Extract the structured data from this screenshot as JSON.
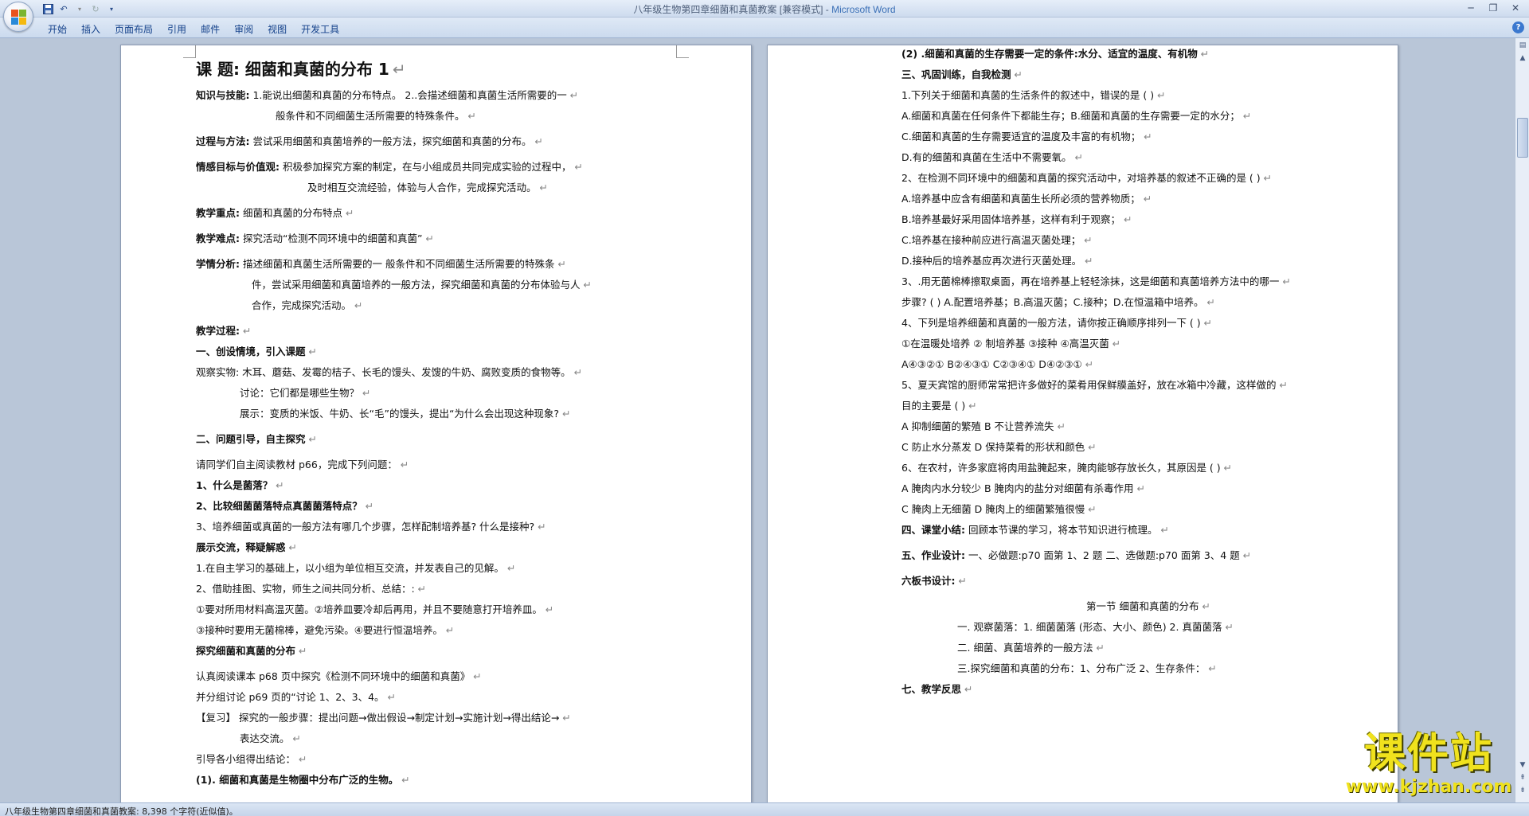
{
  "window": {
    "doc_name": "八年级生物第四章细菌和真菌教案 [兼容模式]",
    "separator": " - ",
    "app_name": "Microsoft Word"
  },
  "tabs": [
    "开始",
    "插入",
    "页面布局",
    "引用",
    "邮件",
    "审阅",
    "视图",
    "开发工具"
  ],
  "status": "八年级生物第四章细菌和真菌教案: 8,398 个字符(近似值)。",
  "watermark": {
    "logo": "课件站",
    "url": "www.kjzhan.com"
  },
  "left_page": [
    {
      "t": "课  题:            细菌和真菌的分布               1",
      "s": "h1"
    },
    {
      "t": "知识与技能:  1.能说出细菌和真菌的分布特点。 2..会描述细菌和真菌生活所需要的一",
      "s": "b-lead"
    },
    {
      "t": "般条件和不同细菌生活所需要的特殊条件。",
      "s": "ind1"
    },
    {
      "t": "过程与方法:   尝试采用细菌和真菌培养的一般方法，探究细菌和真菌的分布。",
      "s": "b-lead gap"
    },
    {
      "t": "情感目标与价值观:   积极参加探究方案的制定，在与小组成员共同完成实验的过程中，",
      "s": "b-lead gap"
    },
    {
      "t": "及时相互交流经验，体验与人合作，完成探究活动。",
      "s": "ind4"
    },
    {
      "t": "教学重点:   细菌和真菌的分布特点",
      "s": "b-lead gap"
    },
    {
      "t": "教学难点:    探究活动“检测不同环境中的细菌和真菌”",
      "s": "b-lead gap"
    },
    {
      "t": "学情分析: 描述细菌和真菌生活所需要的一   般条件和不同细菌生活所需要的特殊条",
      "s": "b-lead gap"
    },
    {
      "t": "件，尝试采用细菌和真菌培养的一般方法，探究细菌和真菌的分布体验与人",
      "s": "ind3"
    },
    {
      "t": "合作，完成探究活动。",
      "s": "ind3"
    },
    {
      "t": "教学过程:",
      "s": "b gap"
    },
    {
      "t": "一、创设情境，引入课题",
      "s": "b"
    },
    {
      "t": "观察实物: 木耳、蘑菇、发霉的桔子、长毛的馒头、发馊的牛奶、腐败变质的食物等。",
      "s": ""
    },
    {
      "t": "讨论：它们都是哪些生物？",
      "s": "ind2"
    },
    {
      "t": "展示：变质的米饭、牛奶、长“毛”的馒头，提出“为什么会出现这种现象?",
      "s": "ind2"
    },
    {
      "t": "二、问题引导，自主探究",
      "s": "b gap"
    },
    {
      "t": " 请同学们自主阅读教材 p66，完成下列问题：",
      "s": "gap"
    },
    {
      "t": "1、什么是菌落？",
      "s": "b"
    },
    {
      "t": "2、比较细菌菌落特点真菌菌落特点？",
      "s": "b"
    },
    {
      "t": "3、培养细菌或真菌的一般方法有哪几个步骤，怎样配制培养基? 什么是接种?",
      "s": ""
    },
    {
      "t": "展示交流，释疑解惑",
      "s": "b"
    },
    {
      "t": "1.在自主学习的基础上，以小组为单位相互交流，并发表自己的见解。",
      "s": ""
    },
    {
      "t": "2、借助挂图、实物，师生之间共同分析、总结：:",
      "s": ""
    },
    {
      "t": "①要对所用材料高温灭菌。②培养皿要冷却后再用，并且不要随意打开培养皿。",
      "s": ""
    },
    {
      "t": "③接种时要用无菌棉棒，避免污染。④要进行恒温培养。",
      "s": ""
    },
    {
      "t": "探究细菌和真菌的分布",
      "s": "b"
    },
    {
      "t": "认真阅读课本 p68 页中探究《检测不同环境中的细菌和真菌》",
      "s": "gap"
    },
    {
      "t": "并分组讨论 p69 页的“讨论 1、2、3、4。",
      "s": ""
    },
    {
      "t": "【复习】 探究的一般步骤：提出问题→做出假设→制定计划→实施计划→得出结论→",
      "s": ""
    },
    {
      "t": "表达交流。",
      "s": "ind2"
    },
    {
      "t": "引导各小组得出结论：",
      "s": ""
    },
    {
      "t": " (1). 细菌和真菌是生物圈中分布广泛的生物。",
      "s": "b"
    }
  ],
  "right_page": [
    {
      "t": " (2) .细菌和真菌的生存需要一定的条件:水分、适宜的温度、有机物",
      "s": "b"
    },
    {
      "t": "三、巩固训练，自我检测",
      "s": "b"
    },
    {
      "t": "1.下列关于细菌和真菌的生活条件的叙述中，错误的是 (      )",
      "s": ""
    },
    {
      "t": "A.细菌和真菌在任何条件下都能生存；B.细菌和真菌的生存需要一定的水分；",
      "s": ""
    },
    {
      "t": "C.细菌和真菌的生存需要适宜的温度及丰富的有机物；",
      "s": ""
    },
    {
      "t": "D.有的细菌和真菌在生活中不需要氧。",
      "s": ""
    },
    {
      "t": "2、在检测不同环境中的细菌和真菌的探究活动中，对培养基的叙述不正确的是 (     )",
      "s": ""
    },
    {
      "t": "A.培养基中应含有细菌和真菌生长所必须的营养物质；",
      "s": ""
    },
    {
      "t": "B.培养基最好采用固体培养基，这样有利于观察；",
      "s": ""
    },
    {
      "t": "C.培养基在接种前应进行高温灭菌处理；",
      "s": ""
    },
    {
      "t": "D.接种后的培养基应再次进行灭菌处理。",
      "s": ""
    },
    {
      "t": "3、.用无菌棉棒擦取桌面，再在培养基上轻轻涂抹，这是细菌和真菌培养方法中的哪一",
      "s": ""
    },
    {
      "t": "步骤? (     )        A.配置培养基；B.高温灭菌；C.接种；D.在恒温箱中培养。",
      "s": ""
    },
    {
      "t": "4、下列是培养细菌和真菌的一般方法，请你按正确顺序排列一下 (      )",
      "s": ""
    },
    {
      "t": "①在温暖处培养      ② 制培养基       ③接种          ④高温灭菌",
      "s": ""
    },
    {
      "t": "A④③②①       B②④③①       C②③④①      D④②③①",
      "s": ""
    },
    {
      "t": "5、夏天宾馆的厨师常常把许多做好的菜肴用保鲜膜盖好，放在冰箱中冷藏，这样做的",
      "s": ""
    },
    {
      "t": "目的主要是 (    )",
      "s": ""
    },
    {
      "t": "A 抑制细菌的繁殖                B 不让营养流失",
      "s": ""
    },
    {
      "t": "C 防止水分蒸发                  D 保持菜肴的形状和颜色",
      "s": ""
    },
    {
      "t": "6、在农村，许多家庭将肉用盐腌起来，腌肉能够存放长久，其原因是 (     )",
      "s": ""
    },
    {
      "t": "A 腌肉内水分较少                               B 腌肉内的盐分对细菌有杀毒作用",
      "s": ""
    },
    {
      "t": "C 腌肉上无细菌                                 D 腌肉上的细菌繁殖很慢",
      "s": ""
    },
    {
      "t": "四、课堂小结: 回顾本节课的学习，将本节知识进行梳理。",
      "s": "b-lead"
    },
    {
      "t": "五、作业设计: 一、必做题:p70 面第 1、2 题    二、选做题:p70 面第 3、4 题",
      "s": "b-lead gap"
    },
    {
      "t": "六板书设计:",
      "s": "b gap"
    },
    {
      "t": "第一节   细菌和真菌的分布",
      "s": "c gap"
    },
    {
      "t": "一. 观察菌落：1. 细菌菌落  (形态、大小、颜色)         2. 真菌菌落",
      "s": "ind3"
    },
    {
      "t": "二. 细菌、真菌培养的一般方法",
      "s": "ind3"
    },
    {
      "t": "三.探究细菌和真菌的分布：1、分布广泛 2、生存条件：",
      "s": "ind3"
    },
    {
      "t": "七、教学反思",
      "s": "b"
    }
  ]
}
